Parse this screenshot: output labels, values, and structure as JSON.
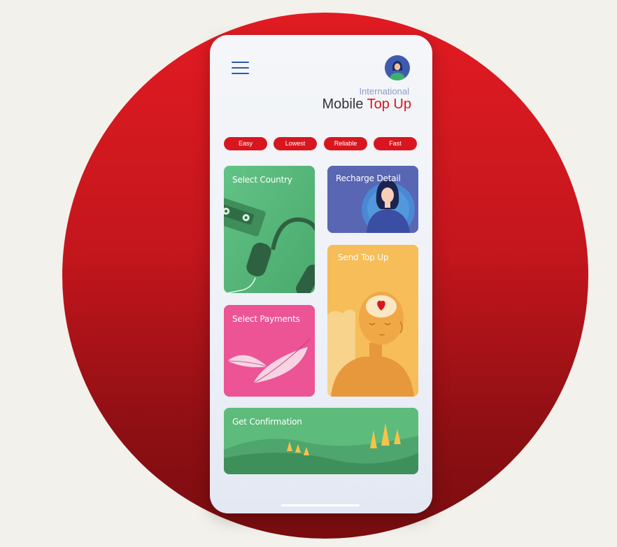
{
  "header": {
    "brand_line1": "International",
    "brand_word1": "Mobile",
    "brand_word2": "Top Up"
  },
  "tags": [
    "Easy",
    "Lowest",
    "Reliable",
    "Fast"
  ],
  "cards": {
    "select_country": "Select Country",
    "recharge_detail": "Recharge Detail",
    "send_top_up": "Send Top Up",
    "select_payments": "Select Payments",
    "get_confirmation": "Get Confirmation"
  },
  "colors": {
    "brand_red": "#d8161f",
    "country_card": "#5bbb7b",
    "recharge_card": "#5866b3",
    "send_card": "#f6bd58",
    "payment_card": "#ec5496",
    "confirm_card": "#5dbb7c"
  },
  "icons": {
    "menu": "hamburger-menu-icon",
    "avatar": "user-avatar"
  }
}
